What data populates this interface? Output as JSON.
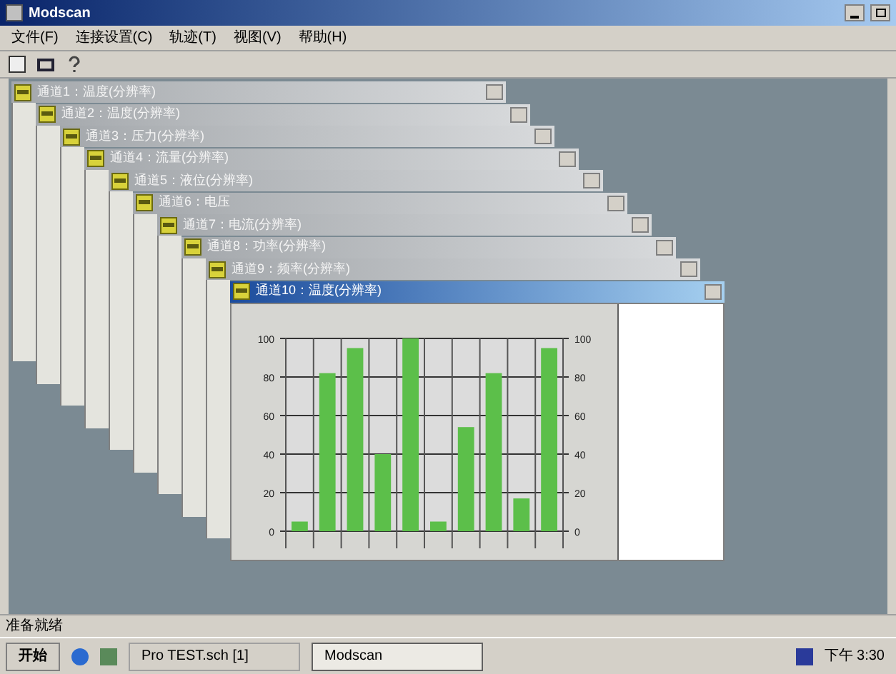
{
  "window": {
    "title": "Modscan"
  },
  "menu": [
    "文件(F)",
    "连接设置(C)",
    "轨迹(T)",
    "视图(V)",
    "帮助(H)"
  ],
  "children": [
    {
      "title": "通道1：温度(分辨率)",
      "selected": false
    },
    {
      "title": "通道2：温度(分辨率)",
      "selected": false
    },
    {
      "title": "通道3：压力(分辨率)",
      "selected": false
    },
    {
      "title": "通道4：流量(分辨率)",
      "selected": false
    },
    {
      "title": "通道5：液位(分辨率)",
      "selected": false
    },
    {
      "title": "通道6：电压",
      "selected": false
    },
    {
      "title": "通道7：电流(分辨率)",
      "selected": false
    },
    {
      "title": "通道8：功率(分辨率)",
      "selected": false
    },
    {
      "title": "通道9：频率(分辨率)",
      "selected": false
    },
    {
      "title": "通道10：温度(分辨率)",
      "selected": true
    }
  ],
  "chart_data": {
    "type": "bar",
    "values": [
      5,
      82,
      95,
      40,
      100,
      5,
      54,
      82,
      17,
      95
    ],
    "ylim": [
      0,
      100
    ],
    "yticks": [
      0,
      20,
      40,
      60,
      80,
      100
    ],
    "grid": true
  },
  "right_axis_labels": [
    "100",
    "80",
    "60",
    "40",
    "20",
    "0"
  ],
  "status_bar": "准备就绪",
  "taskbar": {
    "start": "开始",
    "tasks": [
      {
        "label": "Pro TEST.sch [1]",
        "selected": false
      },
      {
        "label": "Modscan",
        "selected": true
      }
    ],
    "clock": "下午 3:30"
  }
}
